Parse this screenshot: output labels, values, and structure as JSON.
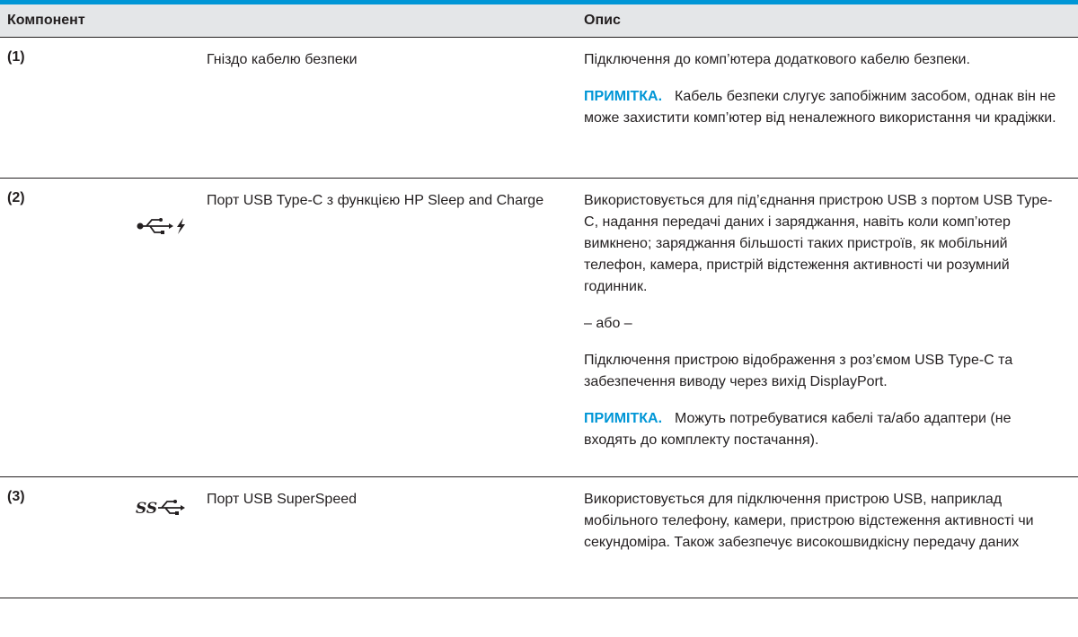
{
  "table": {
    "headers": {
      "component": "Компонент",
      "description": "Опис"
    },
    "rows": [
      {
        "number": "(1)",
        "icon": "",
        "name": "Гніздо кабелю безпеки",
        "desc": [
          {
            "note_label": "",
            "text": "Підключення до комп’ютера додаткового кабелю безпеки."
          },
          {
            "note_label": "ПРИМІТКА.",
            "text": "Кабель безпеки слугує запобіжним засобом, однак він не може захистити комп’ютер від неналежного використання чи крадіжки."
          }
        ]
      },
      {
        "number": "(2)",
        "icon": "usb-charge-icon",
        "name": "Порт USB Type-C з функцією HP Sleep and Charge",
        "desc": [
          {
            "note_label": "",
            "text": "Використовується для під’єднання пристрою USB з портом USB Type-C, надання передачі даних і заряджання, навіть коли комп’ютер вимкнено; заряджання більшості таких пристроїв, як мобільний телефон, камера, пристрій відстеження активності чи розумний годинник."
          },
          {
            "note_label": "",
            "text": "– або –"
          },
          {
            "note_label": "",
            "text": "Підключення пристрою відображення з роз’ємом USB Type-C та забезпечення виводу через вихід DisplayPort."
          },
          {
            "note_label": "ПРИМІТКА.",
            "text": "Можуть потребуватися кабелі та/або адаптери (не входять до комплекту постачання)."
          }
        ]
      },
      {
        "number": "(3)",
        "icon": "usb-superspeed-icon",
        "name": "Порт USB SuperSpeed",
        "desc": [
          {
            "note_label": "",
            "text": "Використовується для підключення пристрою USB, наприклад мобільного телефону, камери, пристрою відстеження активності чи секундоміра. Також забезпечує високошвидкісну передачу даних"
          }
        ]
      }
    ]
  },
  "colors": {
    "accent": "#0096d6",
    "header_bg": "#e4e6e8",
    "text": "#231f20"
  }
}
